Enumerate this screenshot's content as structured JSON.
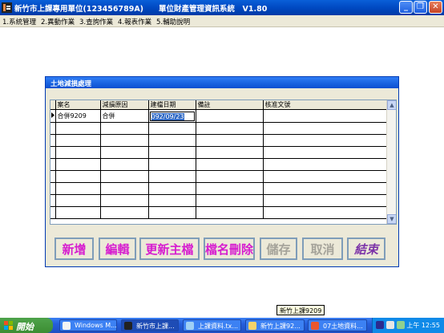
{
  "window": {
    "title": "新竹市上課專用單位(123456789A)　　單位財產管理資訊系統　V1.80",
    "minimize": "_",
    "restore": "❐",
    "close": "✕"
  },
  "menu": [
    {
      "label": "1.系統管理"
    },
    {
      "label": "2.異動作業"
    },
    {
      "label": "3.查詢作業"
    },
    {
      "label": "4.報表作業"
    },
    {
      "label": "5.輔助說明"
    }
  ],
  "dialog": {
    "title": "土地減損處理",
    "columns": [
      "案名",
      "減損原因",
      "建檔日期",
      "備註",
      "核准文號"
    ],
    "row": {
      "case_name": "合併9209",
      "reason": "合併",
      "date": "092/09/23",
      "note": "",
      "approval_no": ""
    },
    "buttons": {
      "add": "新增",
      "edit": "編輯",
      "update_master": "更新主檔",
      "delete_file": "檔名刪除",
      "save": "儲存",
      "cancel": "取消",
      "exit": "結束"
    }
  },
  "taskbar": {
    "start": "開始",
    "tasks": [
      {
        "label": "Windows M..."
      },
      {
        "label": "新竹市上課..."
      },
      {
        "label": "上課資料.tx..."
      },
      {
        "label": "新竹上課92..."
      },
      {
        "label": "07土地資料..."
      }
    ],
    "clock": "上午 12:55",
    "tooltip": "新竹上課9209"
  },
  "colors": {
    "titlebar": "#0049c2",
    "button_text": "#d61ccf",
    "disabled_text": "#a5a39a",
    "selection": "#316ac5"
  }
}
